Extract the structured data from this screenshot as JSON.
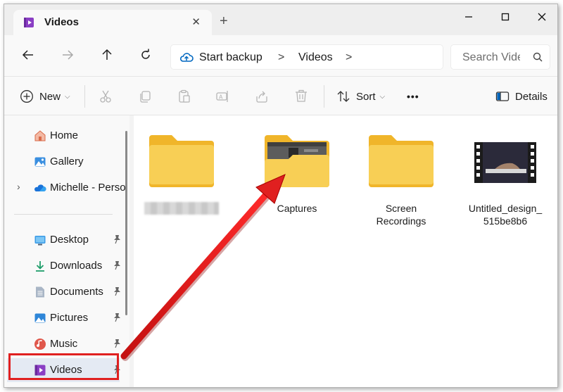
{
  "window": {
    "tab_title": "Videos",
    "new_tab_symbol": "+",
    "tab_close_symbol": "✕"
  },
  "address": {
    "crumbs": [
      "Start backup",
      "Videos"
    ],
    "separator": ">",
    "search_placeholder": "Search Videos"
  },
  "toolbar": {
    "new_label": "New",
    "sort_label": "Sort",
    "more_label": "•••",
    "details_label": "Details"
  },
  "sidebar": {
    "items": [
      {
        "label": "Home",
        "icon": "home-icon",
        "pinned": false
      },
      {
        "label": "Gallery",
        "icon": "gallery-icon",
        "pinned": false
      },
      {
        "label": "Michelle - Perso",
        "icon": "onedrive-cloud-icon",
        "pinned": false,
        "expandable": true
      },
      {
        "label": "Desktop",
        "icon": "desktop-icon",
        "pinned": true
      },
      {
        "label": "Downloads",
        "icon": "download-icon",
        "pinned": true
      },
      {
        "label": "Documents",
        "icon": "documents-icon",
        "pinned": true
      },
      {
        "label": "Pictures",
        "icon": "pictures-icon",
        "pinned": true
      },
      {
        "label": "Music",
        "icon": "music-icon",
        "pinned": true
      },
      {
        "label": "Videos",
        "icon": "videos-icon",
        "pinned": true,
        "selected": true
      }
    ]
  },
  "content": {
    "items": [
      {
        "name": "",
        "kind": "folder",
        "name_blurred": true
      },
      {
        "name": "Captures",
        "kind": "folder-with-preview"
      },
      {
        "name": "Screen Recordings",
        "kind": "folder"
      },
      {
        "name": "Untitled_design_ 515be8b6",
        "kind": "video-file"
      }
    ]
  },
  "annotation": {
    "highlight_color": "#e02020",
    "arrow_color": "#e02020"
  },
  "colors": {
    "folder_yellow": "#f8c94a",
    "folder_back": "#f0b52a",
    "accent": "#0067c0",
    "videos_purple": "#8a3ec4"
  }
}
